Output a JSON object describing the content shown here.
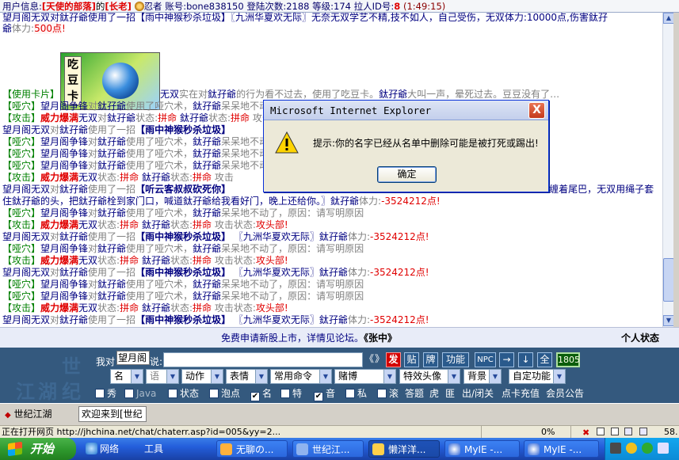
{
  "topbar": {
    "label": "用户信息:",
    "group": "[天使的部落]",
    "of": "的",
    "rank": "[长老]",
    "role": "忍者",
    "account_label": "账号:",
    "account": "bone838150",
    "logins_label": "登陆次数:",
    "logins": "2188",
    "level_label": "等级:",
    "level": "174",
    "invite_label": "拉人ID号:",
    "invite": "8",
    "time": "(1:49:15)"
  },
  "chat": {
    "line0": "望月阁无双对鈦孖爺使用了一招【雨中神猴秒杀垃圾】〖九洲华夏欢无际〗无奈无双学艺不精,技不如人，自己受伤，无双体力:10000点,伤害鈦孖",
    "line1a": "爺",
    "line1b": "体力:",
    "line1c": "500点",
    "line1d": "!",
    "card_tag": "【使用卡片】",
    "card_text_a": "无双",
    "card_text_b": "实在对",
    "card_text_c": "鈦孖爺",
    "card_text_d": "的行为看不过去，使用了吃豆卡。",
    "card_text_e": "鈦孖爺",
    "card_text_f": "大叫一声，晕死过去。豆豆没有了…",
    "card_label": "吃豆卡",
    "mute_tag": "【哑穴】",
    "attack_tag": "【攻击】",
    "moon": "望月阁争锋",
    "moon_to": "对",
    "target": "鈦孖爺",
    "mute_act": "使用了哑穴术，",
    "mute_res": "呆呆地不动了，原因：请写明原因",
    "power": "威力爆满",
    "wushuang": "无双",
    "state_label": "状态:",
    "state_val": "拼命",
    "atk_state": "攻击状态:",
    "atk_val": "攻头部!",
    "atk_prefix": "望月阁无双",
    "use_move": "使用了一招",
    "move1": "【雨中神猴秒杀垃圾】",
    "move2": "【听云客叔叔砍死你】",
    "group2": "〖九洲华夏欢无际〗",
    "hp_label": "体力:",
    "hp_val": "-3524212点!",
    "snippet_tail1": "缠着尾巴，无双用绳子套",
    "snippet_line2": "住鈦孖爺的头，把鈦孖爺栓到家门口，喊道鈦孖爺给我看好门，晚上还给你。〗",
    "snippet_t": "攻击"
  },
  "adbar": {
    "text": "免费申请新股上市，详情见论坛。",
    "link": "《张中》",
    "status": "个人状态"
  },
  "input": {
    "to_label": "我对",
    "nick": "望月阁",
    "say_label": "说:",
    "message": "",
    "btn_prev": "《",
    "btn_next": "》",
    "btn_send": "发",
    "btn_paste": "贴",
    "btn_card": "牌",
    "btn_func": "功能",
    "btn_npc": "NPC",
    "btn_right": "→",
    "btn_down": "↓",
    "btn_all": "全",
    "btn_code": "1805",
    "sel_name": "名",
    "sel_lang": "语",
    "sel_action": "动作",
    "sel_mood": "表情",
    "sel_cmd": "常用命令",
    "sel_gamble": "赌博",
    "sel_avatar": "特效头像",
    "sel_bg": "背景",
    "sel_custom": "自定功能",
    "cb_show": "秀",
    "cb_java": "Java",
    "cb_state": "状态",
    "cb_bubble": "泡点",
    "cb_name": "名",
    "cb_special": "特",
    "cb_sound": "音",
    "cb_private": "私",
    "cb_scroll": "滚",
    "link_answer": "答题",
    "link_tiger": "虎",
    "link_bandit": "匪",
    "link_exit": "出/闭关",
    "link_recharge": "点卡充值",
    "link_notice": "会员公告",
    "watermark1": "世",
    "watermark2": "纪",
    "watermark3": "江",
    "watermark4": "湖"
  },
  "tabs": {
    "tab1": "世纪江湖",
    "tab2": "欢迎来到[世纪"
  },
  "statusbar": {
    "text": "正在打开网页 http://jhchina.net/chat/chaterr.asp?id=005&yy=2...",
    "progress": "0%",
    "extra": "58."
  },
  "taskbar": {
    "start": "开始",
    "net": "网络",
    "tools": "工具",
    "item1": "无聊の...",
    "item2": "世纪江...",
    "item3": "懒洋洋...",
    "item4": "MyIE -...",
    "item5": "MyIE -..."
  },
  "dialog": {
    "title": "Microsoft Internet Explorer",
    "message": "提示:你的名字已经从名单中删除可能是被打死或踢出!",
    "ok": "确定",
    "close": "X"
  },
  "colors": {
    "chat_green": "#006400",
    "chat_navy": "#000080",
    "chat_red": "#e00000",
    "input_panel": "#34597e",
    "taskbar": "#245edb"
  }
}
